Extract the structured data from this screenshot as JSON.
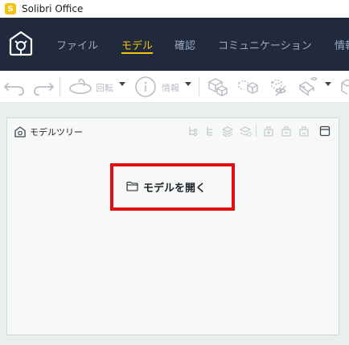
{
  "window": {
    "title": "Solibri Office",
    "logo_letter": "S"
  },
  "nav": {
    "tabs": [
      {
        "label": "ファイル",
        "active": false
      },
      {
        "label": "モデル",
        "active": true
      },
      {
        "label": "確認",
        "active": false
      },
      {
        "label": "コミュニケーション",
        "active": false
      },
      {
        "label": "情報",
        "active": false
      }
    ]
  },
  "toolbar": {
    "rotate_label": "回転",
    "info_label": "情報"
  },
  "panel": {
    "title": "モデルツリー",
    "open_model_label": "モデルを開く"
  },
  "colors": {
    "nav_background": "#202a3c",
    "accent": "#f5c211",
    "highlight_border": "#e10f0f"
  }
}
